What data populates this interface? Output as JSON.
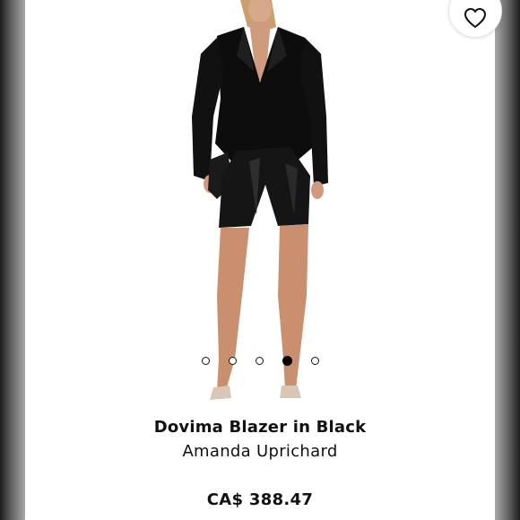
{
  "product": {
    "title": "Dovima Blazer in Black",
    "brand": "Amanda Uprichard",
    "price": "CA$ 388.47"
  },
  "carousel": {
    "total": 5,
    "active_index": 3
  },
  "icons": {
    "favorite": "heart-outline-icon"
  },
  "colors": {
    "text": "#111111",
    "background": "#ffffff",
    "frame": "#2b2b2b"
  }
}
